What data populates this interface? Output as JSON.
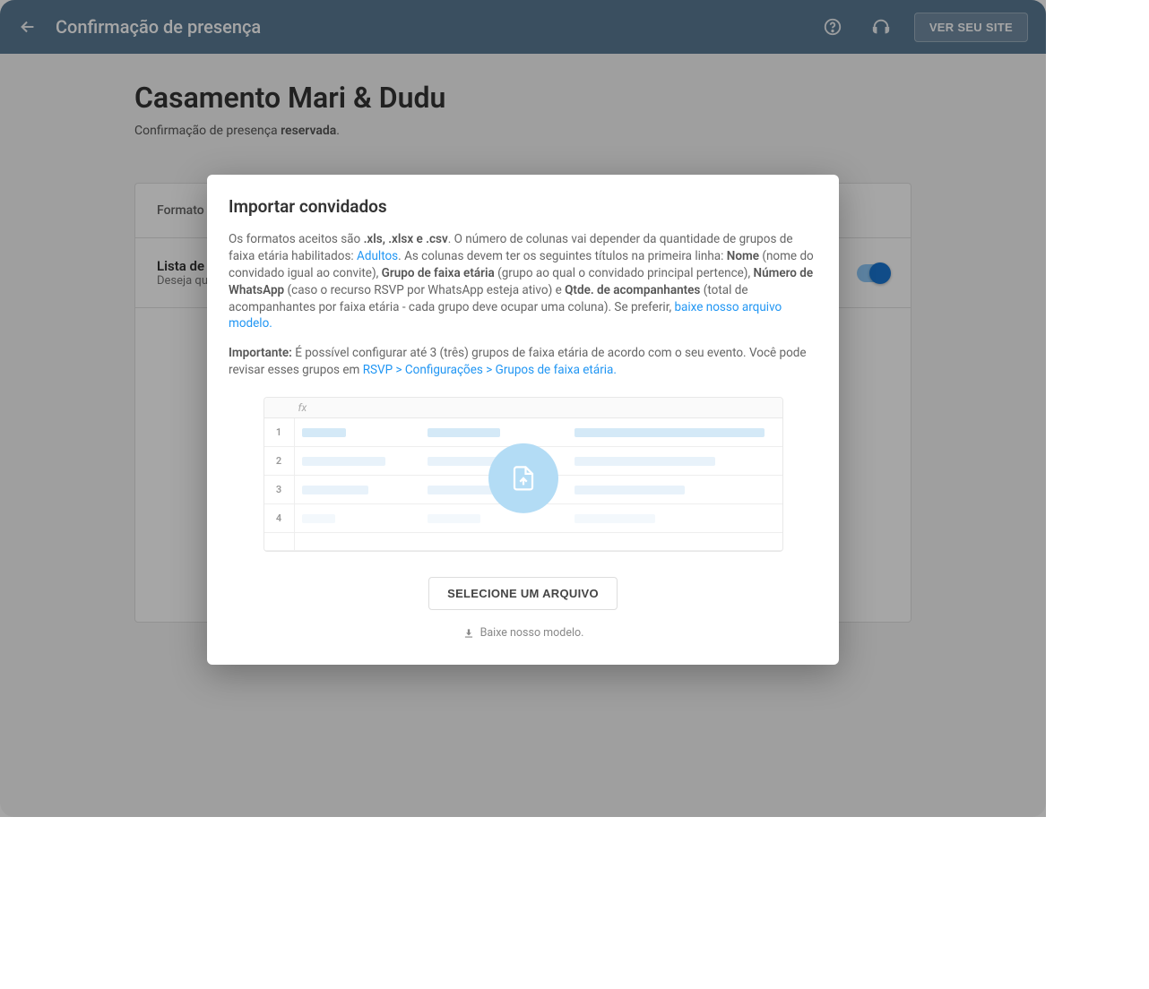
{
  "header": {
    "title": "Confirmação de presença",
    "view_site": "VER SEU SITE"
  },
  "page": {
    "title": "Casamento Mari & Dudu",
    "subtitle_prefix": "Confirmação de presença ",
    "subtitle_bold": "reservada",
    "subtitle_suffix": "."
  },
  "card": {
    "format_label": "Formato",
    "row_title": "Lista de p",
    "row_sub": "Deseja que "
  },
  "modal": {
    "title": "Importar convidados",
    "p1_a": "Os formatos aceitos são ",
    "p1_b": ".xls, .xlsx e .csv",
    "p1_c": ". O número de colunas vai depender da quantidade de grupos de faixa etária habilitados: ",
    "p1_link1": "Adultos",
    "p1_d": ". As colunas devem ter os seguintes títulos na primeira linha: ",
    "p1_e": "Nome",
    "p1_f": " (nome do convidado igual ao convite), ",
    "p1_g": "Grupo de faixa etária",
    "p1_h": " (grupo ao qual o convidado principal pertence), ",
    "p1_i": "Número de WhatsApp",
    "p1_j": " (caso o recurso RSVP por WhatsApp esteja ativo) e ",
    "p1_k": "Qtde. de acompanhantes",
    "p1_l": " (total de acompanhantes por faixa etária - cada grupo deve ocupar uma coluna). Se preferir, ",
    "p1_link2": "baixe nosso arquivo modelo.",
    "p2_a": "Importante:",
    "p2_b": " É possível configurar até 3 (três) grupos de faixa etária de acordo com o seu evento. Você pode revisar esses grupos em ",
    "p2_link": "RSVP > Configurações > Grupos de faixa etária.",
    "fx": "fx",
    "rows": [
      "1",
      "2",
      "3",
      "4"
    ],
    "select_file": "SELECIONE UM ARQUIVO",
    "download_model": "Baixe nosso modelo."
  }
}
